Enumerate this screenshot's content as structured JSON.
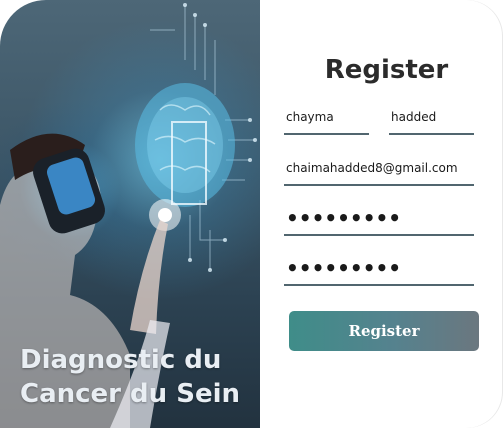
{
  "hero": {
    "title_line1": "Diagnostic du",
    "title_line2": "Cancer du Sein",
    "image_icon": "vr-brain-illustration-icon"
  },
  "form": {
    "title": "Register",
    "first_name": "chayma",
    "last_name": "hadded",
    "email": "chaimahadded8@gmail.com",
    "password": "•••••••••",
    "confirm_password": "•••••••••",
    "submit_label": "Register"
  },
  "colors": {
    "button_start": "#3f8d89",
    "button_end": "#6b777f",
    "underline": "#51666f"
  }
}
